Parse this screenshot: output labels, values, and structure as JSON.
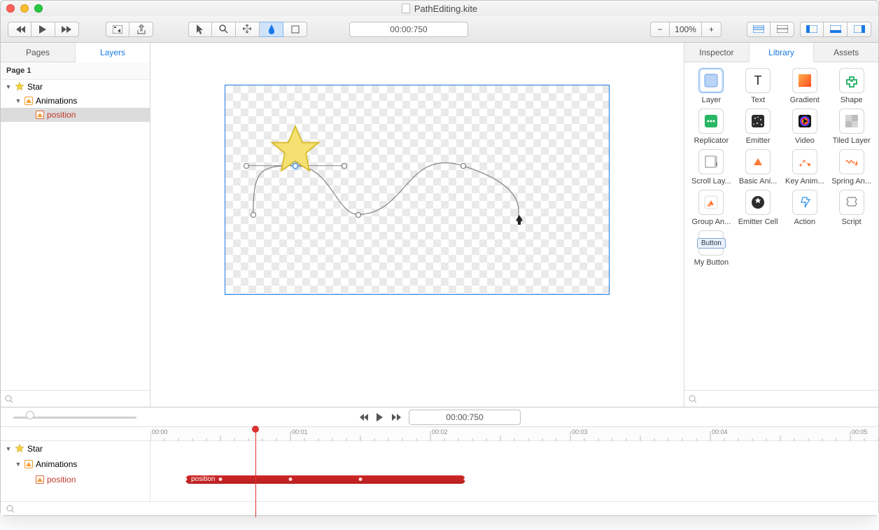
{
  "window": {
    "title": "PathEditing.kite"
  },
  "toolbar": {
    "time": "00:00:750",
    "zoom": {
      "minus": "−",
      "value": "100%",
      "plus": "+"
    }
  },
  "leftTabs": {
    "pages": "Pages",
    "layers": "Layers",
    "active": "Layers"
  },
  "pageHeader": "Page 1",
  "tree": {
    "star": "Star",
    "animations": "Animations",
    "position": "position"
  },
  "rightTabs": {
    "inspector": "Inspector",
    "library": "Library",
    "assets": "Assets",
    "active": "Library"
  },
  "library": [
    {
      "id": "layer",
      "label": "Layer"
    },
    {
      "id": "text",
      "label": "Text"
    },
    {
      "id": "gradient",
      "label": "Gradient"
    },
    {
      "id": "shape",
      "label": "Shape"
    },
    {
      "id": "replicator",
      "label": "Replicator"
    },
    {
      "id": "emitter",
      "label": "Emitter"
    },
    {
      "id": "video",
      "label": "Video"
    },
    {
      "id": "tiledlayer",
      "label": "Tiled Layer"
    },
    {
      "id": "scrolllayer",
      "label": "Scroll Lay..."
    },
    {
      "id": "basicanim",
      "label": "Basic Ani..."
    },
    {
      "id": "keyanim",
      "label": "Key Anim..."
    },
    {
      "id": "springanim",
      "label": "Spring An..."
    },
    {
      "id": "groupanim",
      "label": "Group An..."
    },
    {
      "id": "emittercell",
      "label": "Emitter Cell"
    },
    {
      "id": "action",
      "label": "Action"
    },
    {
      "id": "script",
      "label": "Script"
    },
    {
      "id": "mybutton",
      "label": "My Button"
    }
  ],
  "timeline": {
    "time": "00:00:750",
    "ruler": [
      "00:00",
      "00:01",
      "00:02",
      "00:03",
      "00:04",
      "00:05"
    ],
    "playheadSec": 0.75,
    "tree": {
      "star": "Star",
      "animations": "Animations",
      "position": "position"
    },
    "track": {
      "label": "position",
      "startSec": 0.25,
      "endSec": 2.25,
      "keyframes": [
        0.25,
        0.5,
        1.0,
        1.5,
        2.25
      ]
    }
  }
}
